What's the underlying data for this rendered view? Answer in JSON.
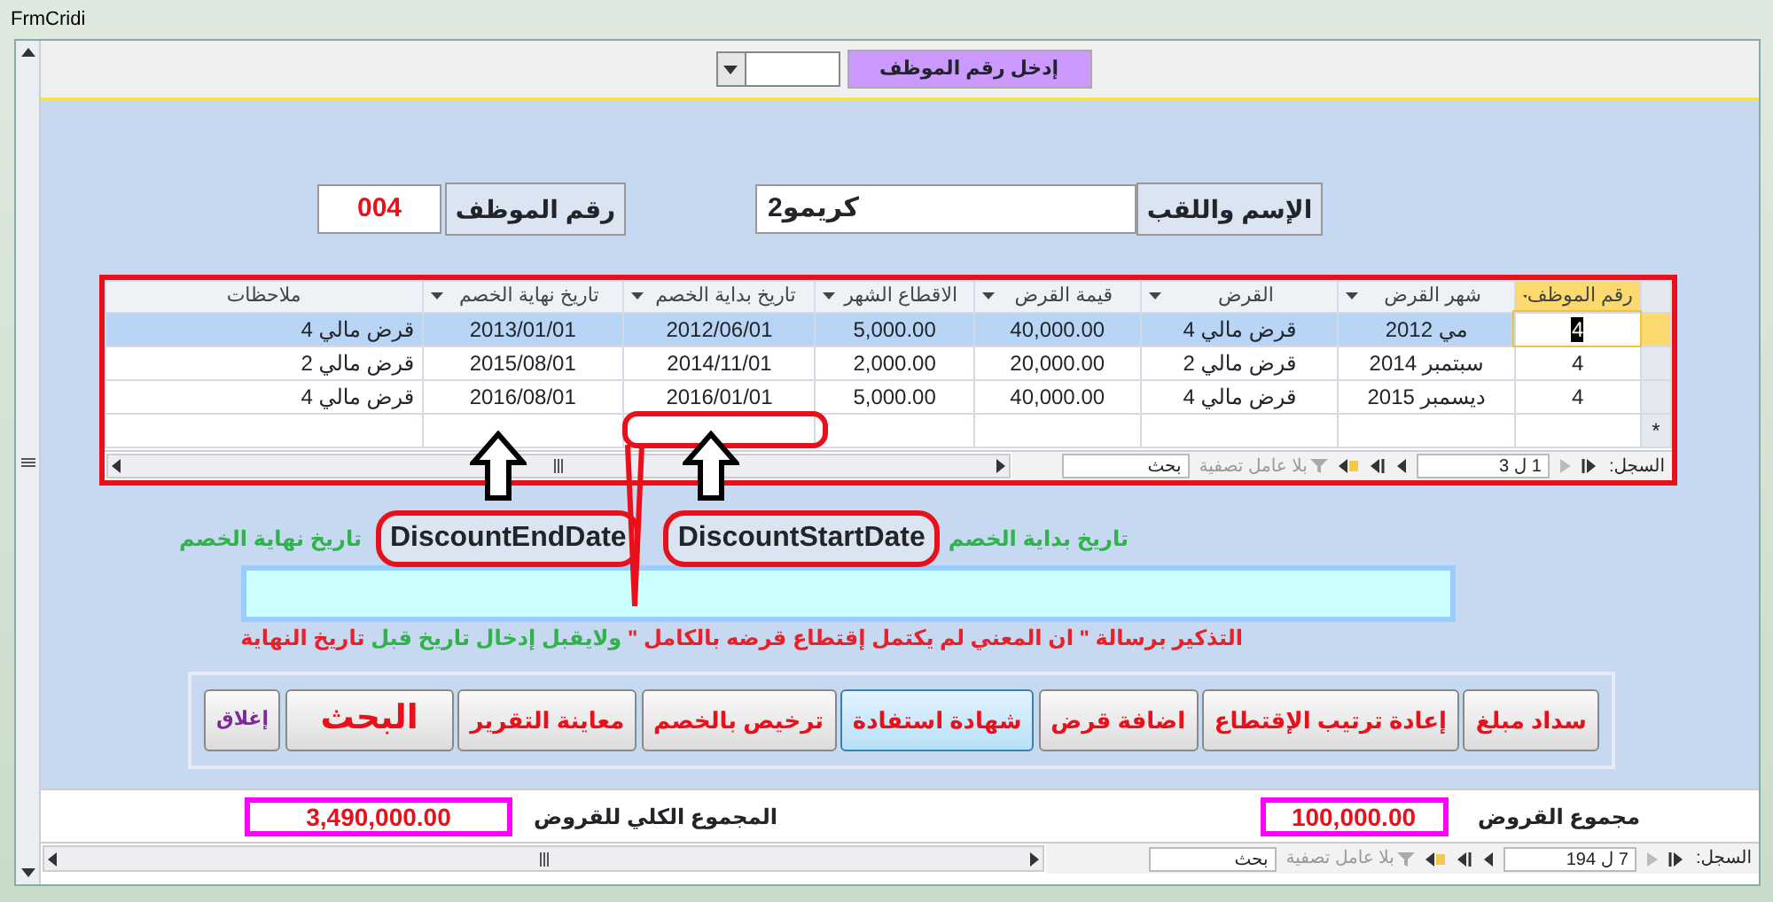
{
  "window": {
    "title": "FrmCridi"
  },
  "employee_picker": {
    "label": "إدخل رقم الموظف"
  },
  "employee": {
    "name_label": "الإسم واللقب",
    "name": "كريمو2",
    "number_label": "رقم الموظف",
    "number": "004"
  },
  "loans_table": {
    "columns": [
      "رقم الموظف",
      "شهر القرض",
      "القرض",
      "قيمة القرض",
      "الاقطاع الشهر",
      "تاريخ بداية الخصم",
      "تاريخ نهاية الخصم",
      "ملاحظات"
    ],
    "rows": [
      {
        "selected": true,
        "cells": [
          "4",
          "مي 2012",
          "قرض مالي 4",
          "40,000.00",
          "5,000.00",
          "2012/06/01",
          "2013/01/01",
          "قرض مالي 4"
        ]
      },
      {
        "selected": false,
        "cells": [
          "4",
          "سبتمبر 2014",
          "قرض مالي 2",
          "20,000.00",
          "2,000.00",
          "2014/11/01",
          "2015/08/01",
          "قرض مالي 2"
        ]
      },
      {
        "selected": false,
        "cells": [
          "4",
          "ديسمبر 2015",
          "قرض مالي 4",
          "40,000.00",
          "5,000.00",
          "2016/01/01",
          "2016/08/01",
          "قرض مالي 4"
        ]
      }
    ],
    "new_row_marker": "*",
    "navigator": {
      "label": "السجل:",
      "position": "1 ل 3",
      "filter": "بلا عامل تصفية",
      "search": "بحث"
    }
  },
  "annotations": {
    "end_label": "تاريخ نهاية الخصم",
    "end_field": "DiscountEndDate",
    "start_field": "DiscountStartDate",
    "start_label": "تاريخ بداية الخصم",
    "note_parts": [
      {
        "text": "التذكير برسالة \" ان المعني لم يكتمل إقتطاع قرضه بالكامل \"",
        "color": "#e8202a"
      },
      {
        "text": " ولايقبل إدخال تاريخ قبل ",
        "color": "#2fb34a"
      },
      {
        "text": "تاريخ النهاية",
        "color": "#e8202a"
      }
    ]
  },
  "buttons": [
    {
      "label": "سداد مبلغ",
      "kind": "normal",
      "color": "#e8101a",
      "highlighted": false
    },
    {
      "label": "إعادة ترتيب الإقتطاع",
      "kind": "normal",
      "color": "#e8101a",
      "highlighted": false
    },
    {
      "label": "اضافة قرض",
      "kind": "normal",
      "color": "#e8101a",
      "highlighted": false
    },
    {
      "label": "شهادة استفادة",
      "kind": "normal",
      "color": "#e8101a",
      "highlighted": true
    },
    {
      "label": "ترخيص بالخصم",
      "kind": "normal",
      "color": "#e8101a",
      "highlighted": false
    },
    {
      "label": "معاينة التقرير",
      "kind": "normal",
      "color": "#e8101a",
      "highlighted": false
    },
    {
      "label": "البحث",
      "kind": "large",
      "color": "#e8101a",
      "highlighted": false
    },
    {
      "label": "إغلاق",
      "kind": "small",
      "color": "#7a2a9a",
      "highlighted": false
    }
  ],
  "totals": [
    {
      "label": "مجموع القروض",
      "value": "100,000.00"
    },
    {
      "label": "المجموع الكلي للقروض",
      "value": "3,490,000.00"
    }
  ],
  "form_navigator": {
    "label": "السجل:",
    "position": "7 ل 194",
    "filter": "بلا عامل تصفية",
    "search": "بحث"
  }
}
